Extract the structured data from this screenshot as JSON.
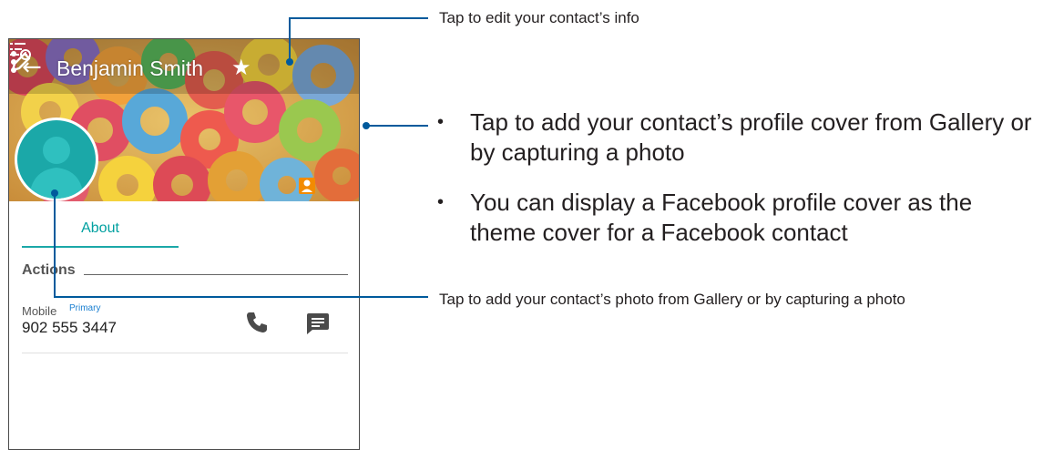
{
  "contact": {
    "name": "Benjamin Smith",
    "tab_about": "About",
    "actions_header": "Actions",
    "mobile_label": "Mobile",
    "primary_label": "Primary",
    "phone_number": "902 555 3447"
  },
  "callouts": {
    "edit_info": "Tap to edit your contact’s info",
    "profile_cover_bullets": [
      "Tap to add your contact’s profile cover from Gallery or by capturing a photo",
      "You can display a Facebook profile cover as the theme cover for a Facebook contact"
    ],
    "contact_photo": "Tap to add your contact’s photo from Gallery or by capturing a photo"
  },
  "colors": {
    "accent": "#1ba8a8",
    "callout_line": "#005a9c",
    "primary_blue": "#1a7fd0"
  },
  "icons": {
    "back": "back-arrow-icon",
    "star": "star-icon",
    "edit": "edit-pencil-icon",
    "more": "more-vert-icon",
    "call": "phone-icon",
    "message": "message-icon",
    "contact_badge": "contact-badge-icon",
    "history": "call-history-icon"
  }
}
